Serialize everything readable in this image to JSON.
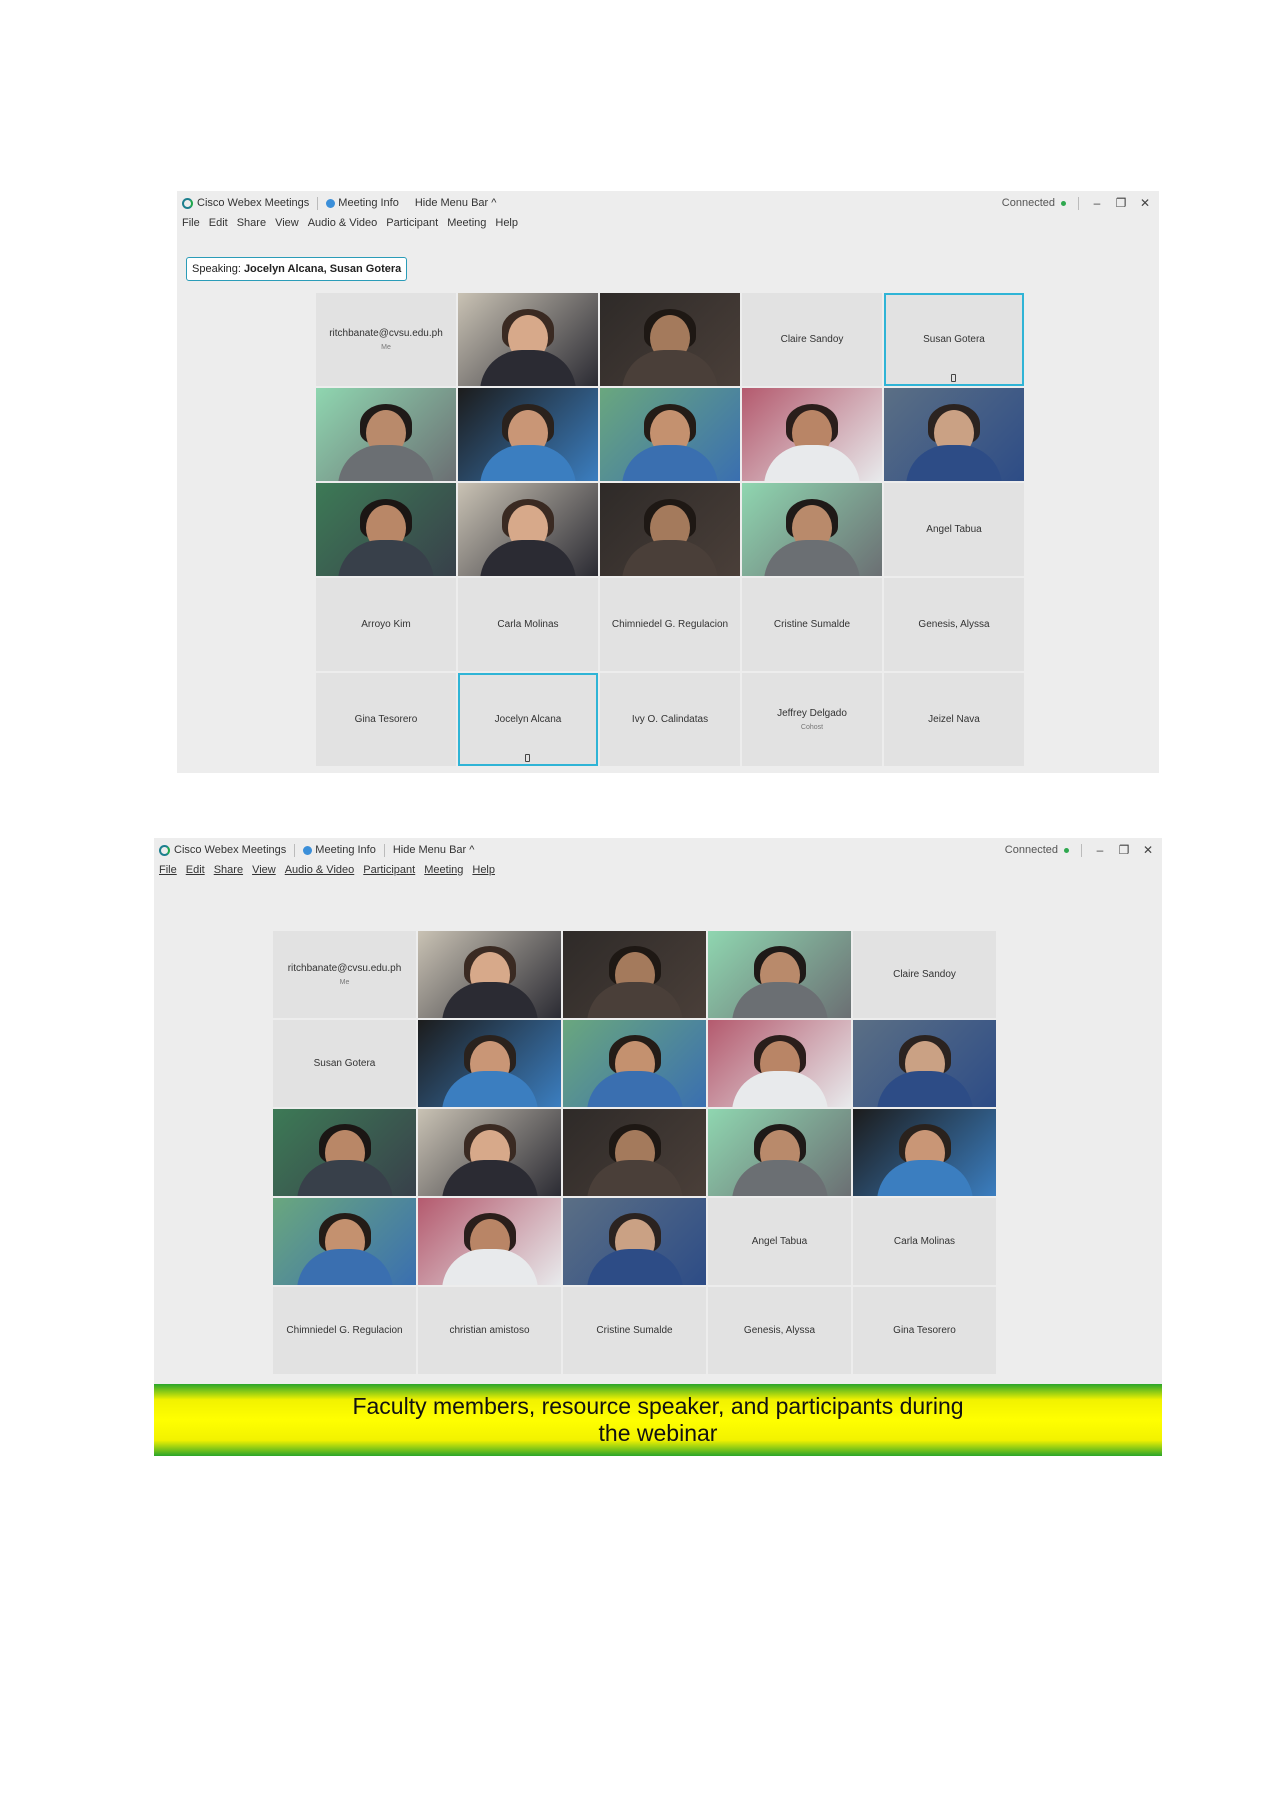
{
  "screenshot1": {
    "titlebar": {
      "app_title": "Cisco Webex Meetings",
      "meeting_info": "Meeting Info",
      "hide_menu_bar": "Hide Menu Bar ^",
      "status": "Connected",
      "minimize": "–",
      "restore": "❐",
      "close": "✕"
    },
    "menu": [
      "File",
      "Edit",
      "Share",
      "View",
      "Audio & Video",
      "Participant",
      "Meeting",
      "Help"
    ],
    "speaking_label": "Speaking:",
    "speaking_names": "Jocelyn Alcana, Susan Gotera",
    "tiles": [
      {
        "name": "ritchbanate@cvsu.edu.ph",
        "sub": "Me"
      },
      {
        "video": true
      },
      {
        "video": true
      },
      {
        "name": "Claire Sandoy"
      },
      {
        "name": "Susan Gotera",
        "active": true
      },
      {
        "video": true
      },
      {
        "video": true
      },
      {
        "video": true
      },
      {
        "video": true
      },
      {
        "video": true
      },
      {
        "video": true
      },
      {
        "video": true
      },
      {
        "video": true
      },
      {
        "video": true
      },
      {
        "name": "Angel Tabua"
      },
      {
        "name": "Arroyo Kim"
      },
      {
        "name": "Carla Molinas"
      },
      {
        "name": "Chimniedel G. Regulacion"
      },
      {
        "name": "Cristine Sumalde"
      },
      {
        "name": "Genesis, Alyssa"
      },
      {
        "name": "Gina Tesorero"
      },
      {
        "name": "Jocelyn Alcana",
        "active": true
      },
      {
        "name": "Ivy O. Calindatas"
      },
      {
        "name": "Jeffrey Delgado",
        "sub": "Cohost"
      },
      {
        "name": "Jeizel Nava"
      }
    ]
  },
  "screenshot2": {
    "titlebar": {
      "app_title": "Cisco Webex Meetings",
      "meeting_info": "Meeting Info",
      "hide_menu_bar": "Hide Menu Bar ^",
      "status": "Connected",
      "minimize": "–",
      "restore": "❐",
      "close": "✕"
    },
    "menu": [
      "File",
      "Edit",
      "Share",
      "View",
      "Audio & Video",
      "Participant",
      "Meeting",
      "Help"
    ],
    "tiles": [
      {
        "name": "ritchbanate@cvsu.edu.ph",
        "sub": "Me"
      },
      {
        "video": true
      },
      {
        "video": true
      },
      {
        "video": true
      },
      {
        "name": "Claire Sandoy"
      },
      {
        "name": "Susan Gotera"
      },
      {
        "video": true
      },
      {
        "video": true
      },
      {
        "video": true
      },
      {
        "video": true
      },
      {
        "video": true
      },
      {
        "video": true
      },
      {
        "video": true
      },
      {
        "video": true
      },
      {
        "video": true
      },
      {
        "video": true
      },
      {
        "video": true
      },
      {
        "video": true
      },
      {
        "name": "Angel Tabua"
      },
      {
        "name": "Carla Molinas"
      },
      {
        "name": "Chimniedel G. Regulacion"
      },
      {
        "name": "christian amistoso"
      },
      {
        "name": "Cristine Sumalde"
      },
      {
        "name": "Genesis, Alyssa"
      },
      {
        "name": "Gina Tesorero"
      }
    ]
  },
  "caption_line1": "Faculty members, resource speaker, and participants during",
  "caption_line2": "the webinar",
  "colors": {
    "active_border": "#2fb4d6",
    "tile_bg": "#e2e2e2",
    "window_bg": "#ededed",
    "caption_yellow": "#ffff00",
    "caption_green": "#2aa52a"
  }
}
